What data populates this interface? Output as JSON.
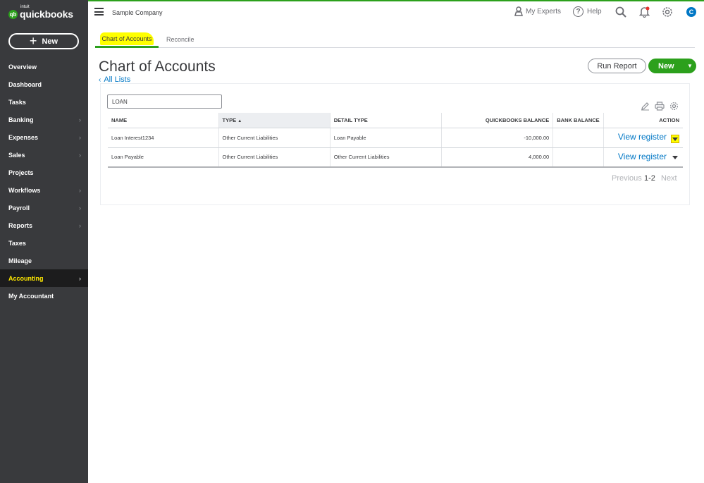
{
  "app": {
    "logo_small": "intuit",
    "logo_name": "quickbooks",
    "company": "Sample Company",
    "brand_color": "#2ca01c",
    "accent_color": "#0077c5"
  },
  "sidebar": {
    "new_label": "New",
    "items": [
      {
        "label": "Overview",
        "chevron": false
      },
      {
        "label": "Dashboard",
        "chevron": false
      },
      {
        "label": "Tasks",
        "chevron": false
      },
      {
        "label": "Banking",
        "chevron": true
      },
      {
        "label": "Expenses",
        "chevron": true
      },
      {
        "label": "Sales",
        "chevron": true
      },
      {
        "label": "Projects",
        "chevron": false
      },
      {
        "label": "Workflows",
        "chevron": true
      },
      {
        "label": "Payroll",
        "chevron": true
      },
      {
        "label": "Reports",
        "chevron": true
      },
      {
        "label": "Taxes",
        "chevron": false
      },
      {
        "label": "Mileage",
        "chevron": false
      },
      {
        "label": "Accounting",
        "chevron": true,
        "active": true
      },
      {
        "label": "My Accountant",
        "chevron": false
      }
    ]
  },
  "header": {
    "my_experts": "My Experts",
    "help": "Help",
    "avatar_initial": "C",
    "icons": [
      "menu-icon",
      "person-icon",
      "help-icon",
      "search-icon",
      "bell-icon",
      "gear-icon"
    ]
  },
  "tabs": [
    {
      "label": "Chart of Accounts",
      "active": true
    },
    {
      "label": "Reconcile",
      "active": false
    }
  ],
  "page": {
    "title": "Chart of Accounts",
    "back_link": "All Lists",
    "run_report": "Run Report",
    "new_button": "New"
  },
  "filter": {
    "value": "LOAN"
  },
  "table": {
    "columns": [
      "NAME",
      "TYPE",
      "DETAIL TYPE",
      "QUICKBOOKS BALANCE",
      "BANK BALANCE",
      "ACTION"
    ],
    "sorted_column": "TYPE",
    "rows": [
      {
        "name": "Loan Interest1234",
        "type": "Other Current Liabilities",
        "detail_type": "Loan Payable",
        "qb_balance": "-10,000.00",
        "bank_balance": "",
        "action": "View register"
      },
      {
        "name": "Loan Payable",
        "type": "Other Current Liabilities",
        "detail_type": "Other Current Liabilities",
        "qb_balance": "4,000.00",
        "bank_balance": "",
        "action": "View register"
      }
    ]
  },
  "pagination": {
    "previous": "Previous",
    "range": "1-2",
    "next": "Next"
  }
}
